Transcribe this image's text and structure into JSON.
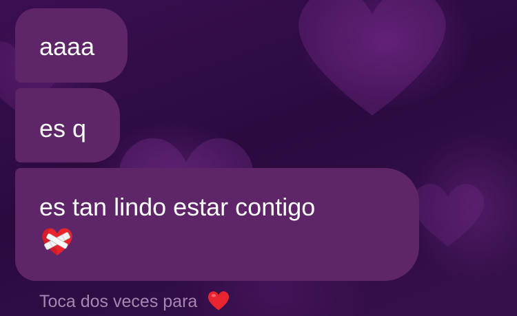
{
  "messages": [
    {
      "text": "aaaa"
    },
    {
      "text": "es q"
    },
    {
      "text": "es tan lindo estar contigo",
      "emoji": "mending-heart"
    }
  ],
  "reaction_hint": {
    "text": "Toca dos veces para",
    "emoji": "red-heart"
  },
  "colors": {
    "background": "#2a0a3d",
    "bubble": "#5e2668",
    "text": "#ffffff",
    "hint_text": "#a786b1",
    "heart": "#e8252f"
  }
}
